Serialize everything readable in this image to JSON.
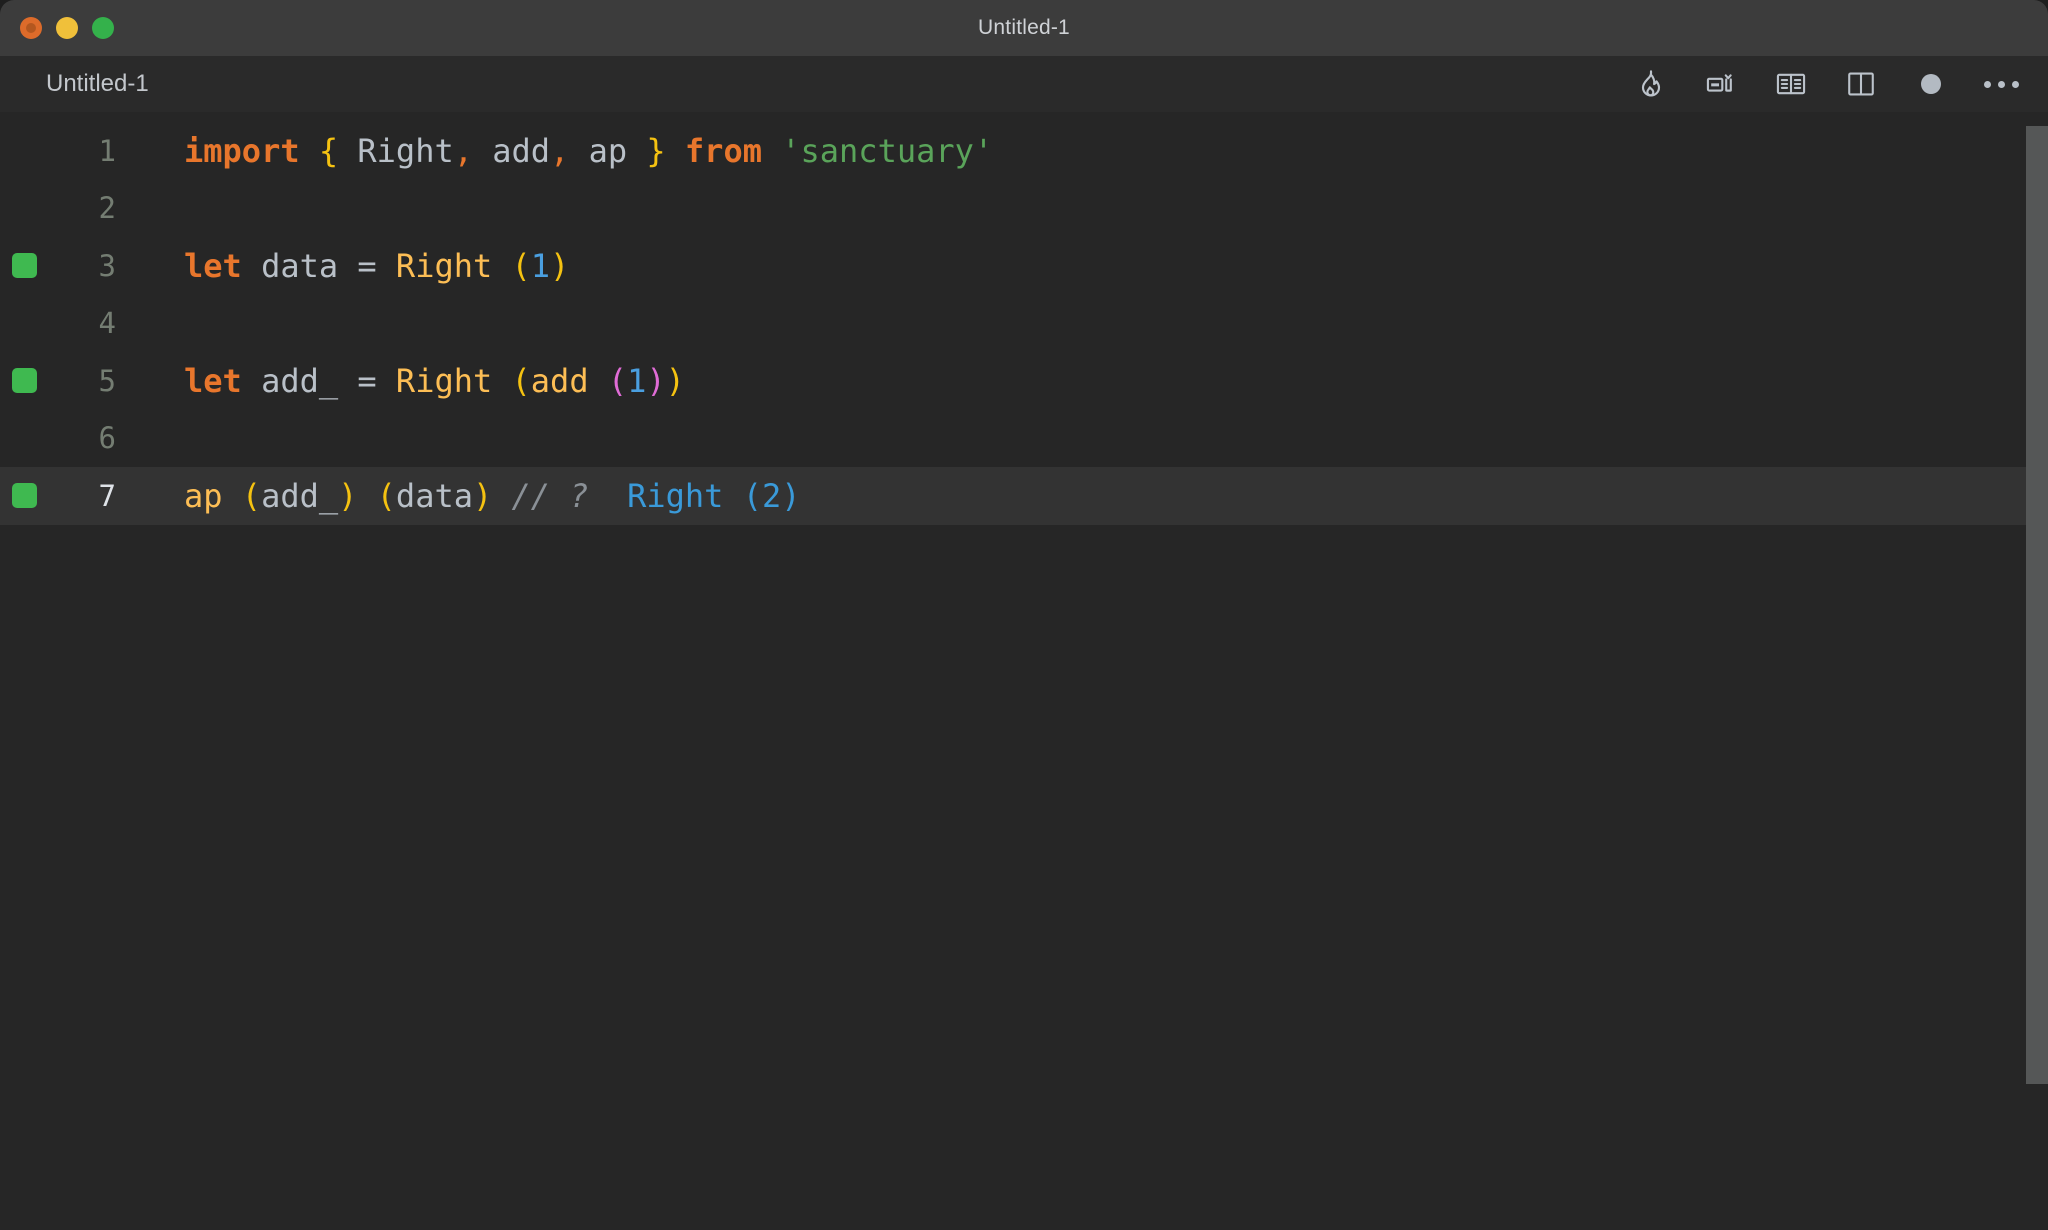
{
  "window": {
    "title": "Untitled-1",
    "traffic_lights": [
      {
        "name": "close",
        "color": "#dd6b2a"
      },
      {
        "name": "minimize",
        "color": "#f0c03a"
      },
      {
        "name": "maximize",
        "color": "#34b14b"
      }
    ]
  },
  "tab": {
    "label": "Untitled-1"
  },
  "toolbar": {
    "icons": [
      {
        "name": "flame-icon",
        "label": "Quokka / Run"
      },
      {
        "name": "split-terminal-icon",
        "label": "Toggle Panel"
      },
      {
        "name": "open-preview-icon",
        "label": "Open Preview"
      },
      {
        "name": "split-editor-icon",
        "label": "Split Editor Right"
      },
      {
        "name": "unsaved-dot-icon",
        "label": "Unsaved changes"
      },
      {
        "name": "more-actions-icon",
        "label": "More Actions..."
      }
    ]
  },
  "editor": {
    "active_line": 7,
    "gutter_marker_color": "#3fb950",
    "lines": [
      {
        "number": "1",
        "marker": false,
        "tokens": [
          {
            "text": "import",
            "cls": "t-key"
          },
          {
            "text": " ",
            "cls": "t-plain"
          },
          {
            "text": "{",
            "cls": "t-brace"
          },
          {
            "text": " Right",
            "cls": "t-plain"
          },
          {
            "text": ",",
            "cls": "t-op"
          },
          {
            "text": " add",
            "cls": "t-plain"
          },
          {
            "text": ",",
            "cls": "t-op"
          },
          {
            "text": " ap ",
            "cls": "t-plain"
          },
          {
            "text": "}",
            "cls": "t-brace"
          },
          {
            "text": " ",
            "cls": "t-plain"
          },
          {
            "text": "from",
            "cls": "t-key"
          },
          {
            "text": " ",
            "cls": "t-plain"
          },
          {
            "text": "'sanctuary'",
            "cls": "t-str"
          }
        ]
      },
      {
        "number": "2",
        "marker": false,
        "tokens": []
      },
      {
        "number": "3",
        "marker": true,
        "tokens": [
          {
            "text": "let",
            "cls": "t-key"
          },
          {
            "text": " data ",
            "cls": "t-plain"
          },
          {
            "text": "=",
            "cls": "t-eq"
          },
          {
            "text": " ",
            "cls": "t-plain"
          },
          {
            "text": "Right",
            "cls": "t-fn"
          },
          {
            "text": " ",
            "cls": "t-plain"
          },
          {
            "text": "(",
            "cls": "t-paren"
          },
          {
            "text": "1",
            "cls": "t-num"
          },
          {
            "text": ")",
            "cls": "t-paren"
          }
        ]
      },
      {
        "number": "4",
        "marker": false,
        "tokens": []
      },
      {
        "number": "5",
        "marker": true,
        "tokens": [
          {
            "text": "let",
            "cls": "t-key"
          },
          {
            "text": " add_ ",
            "cls": "t-plain"
          },
          {
            "text": "=",
            "cls": "t-eq"
          },
          {
            "text": " ",
            "cls": "t-plain"
          },
          {
            "text": "Right",
            "cls": "t-fn"
          },
          {
            "text": " ",
            "cls": "t-plain"
          },
          {
            "text": "(",
            "cls": "t-paren"
          },
          {
            "text": "add",
            "cls": "t-fn"
          },
          {
            "text": " ",
            "cls": "t-plain"
          },
          {
            "text": "(",
            "cls": "t-paren2"
          },
          {
            "text": "1",
            "cls": "t-num"
          },
          {
            "text": ")",
            "cls": "t-paren2"
          },
          {
            "text": ")",
            "cls": "t-paren"
          }
        ]
      },
      {
        "number": "6",
        "marker": false,
        "tokens": []
      },
      {
        "number": "7",
        "marker": true,
        "tokens": [
          {
            "text": "ap",
            "cls": "t-fn"
          },
          {
            "text": " ",
            "cls": "t-plain"
          },
          {
            "text": "(",
            "cls": "t-paren"
          },
          {
            "text": "add_",
            "cls": "t-plain"
          },
          {
            "text": ")",
            "cls": "t-paren"
          },
          {
            "text": " ",
            "cls": "t-plain"
          },
          {
            "text": "(",
            "cls": "t-paren"
          },
          {
            "text": "data",
            "cls": "t-plain"
          },
          {
            "text": ")",
            "cls": "t-paren"
          },
          {
            "text": " ",
            "cls": "t-plain"
          },
          {
            "text": "// ?",
            "cls": "t-com"
          },
          {
            "text": "  ",
            "cls": "t-plain"
          },
          {
            "text": "Right (2)",
            "cls": "t-res"
          }
        ]
      }
    ]
  },
  "scrollbar": {
    "name": "vertical-scrollbar",
    "color": "#555757"
  }
}
